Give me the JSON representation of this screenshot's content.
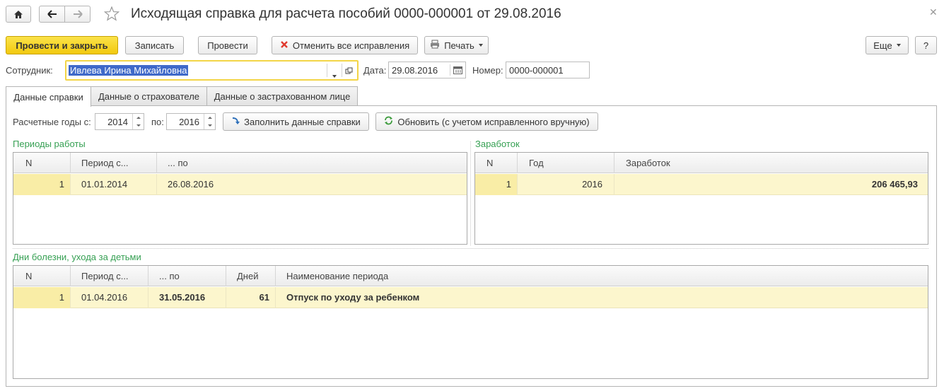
{
  "window": {
    "title": "Исходящая справка для расчета пособий 0000-000001 от 29.08.2016",
    "icons": [
      "home-icon",
      "arrow-left-icon",
      "arrow-right-icon",
      "star-icon",
      "close-icon"
    ]
  },
  "toolbar": {
    "post_and_close": "Провести и закрыть",
    "save": "Записать",
    "post": "Провести",
    "cancel_corrections": "Отменить все исправления",
    "print": "Печать",
    "more": "Еще",
    "help": "?"
  },
  "header": {
    "employee_label": "Сотрудник:",
    "employee_value": "Ивлева Ирина Михайловна",
    "date_label": "Дата:",
    "date_value": "29.08.2016",
    "number_label": "Номер:",
    "number_value": "0000-000001"
  },
  "tabs": [
    {
      "label": "Данные справки",
      "active": true
    },
    {
      "label": "Данные о страхователе",
      "active": false
    },
    {
      "label": "Данные о застрахованном лице",
      "active": false
    }
  ],
  "years": {
    "from_label": "Расчетные годы с:",
    "from_value": "2014",
    "to_label": "по:",
    "to_value": "2016",
    "fill_button": "Заполнить данные справки",
    "refresh_button": "Обновить (с учетом исправленного вручную)"
  },
  "work_periods": {
    "title": "Периоды работы",
    "columns": [
      "N",
      "Период с...",
      "... по"
    ],
    "rows": [
      {
        "n": "1",
        "from": "01.01.2014",
        "to": "26.08.2016"
      }
    ]
  },
  "earnings": {
    "title": "Заработок",
    "columns": [
      "N",
      "Год",
      "Заработок"
    ],
    "rows": [
      {
        "n": "1",
        "year": "2016",
        "amount": "206 465,93"
      }
    ]
  },
  "sick_days": {
    "title": "Дни болезни, ухода за детьми",
    "columns": [
      "N",
      "Период с...",
      "... по",
      "Дней",
      "Наименование периода"
    ],
    "rows": [
      {
        "n": "1",
        "from": "01.04.2016",
        "to": "31.05.2016",
        "days": "61",
        "name": "Отпуск по уходу за ребенком"
      }
    ]
  },
  "colors": {
    "primary_button": "#f2c90e",
    "section_title": "#36a053",
    "selected_row": "#fcf6cd",
    "selection": "#3f69c9"
  }
}
